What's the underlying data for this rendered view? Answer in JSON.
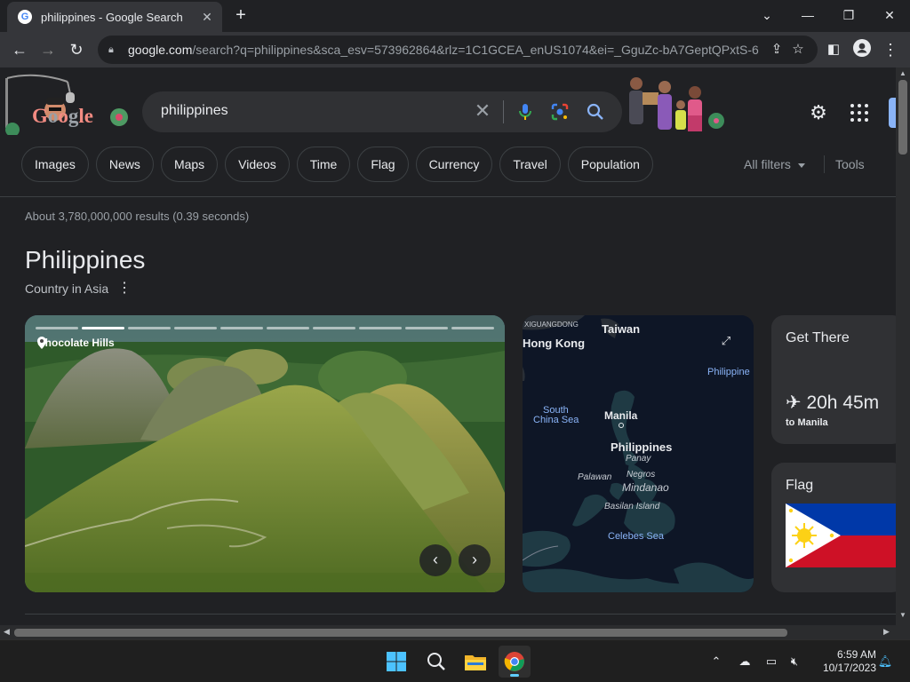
{
  "browser": {
    "tab": {
      "title": "philippines - Google Search",
      "favicon": "google-g-icon"
    },
    "new_tab": "+",
    "window_controls": [
      "minimize",
      "restore",
      "close"
    ],
    "url": "google.com/search?q=philippines&sca_esv=573962864&rlz=1C1GCEA_enUS1074&ei=_GguZc-bA7GeptQPxtS-6...",
    "url_host": "google.com",
    "url_path": "/search?q=philippines&sca_esv=573962864&rlz=1C1GCEA_enUS1074&ei=_GguZc-bA7GeptQPxtS-6..."
  },
  "search": {
    "doodle_text": "Google",
    "query": "philippines",
    "chips": [
      "Images",
      "News",
      "Maps",
      "Videos",
      "Time",
      "Flag",
      "Currency",
      "Travel",
      "Population"
    ],
    "all_filters": "All filters",
    "tools": "Tools",
    "stats": "About 3,780,000,000 results (0.39 seconds)"
  },
  "knowledge_panel": {
    "title": "Philippines",
    "subtitle": "Country in Asia",
    "hero": {
      "location": "Chocolate Hills",
      "slides": 10,
      "active_slide": 2
    },
    "map_labels": {
      "guangdong": "XIGUANGDONG",
      "taiwan": "Taiwan",
      "hong_kong": "Hong Kong",
      "philippine_sea": "Philippine",
      "south_china_sea_1": "South",
      "south_china_sea_2": "China Sea",
      "manila": "Manila",
      "philippines": "Philippines",
      "panay": "Panay",
      "negros": "Negros",
      "palawan": "Palawan",
      "mindanao": "Mindanao",
      "basilan": "Basilan Island",
      "celebes": "Celebes Sea"
    },
    "get_there": {
      "title": "Get There",
      "duration": "20h 45m",
      "destination": "to Manila"
    },
    "flag": {
      "title": "Flag",
      "colors": {
        "blue": "#0038a8",
        "red": "#ce1126",
        "white": "#ffffff",
        "gold": "#fcd116"
      }
    }
  },
  "taskbar": {
    "apps": [
      "windows-start",
      "search",
      "file-explorer",
      "chrome"
    ],
    "time": "6:59 AM",
    "date": "10/17/2023"
  },
  "colors": {
    "accent": "#8ab4f8",
    "background": "#202124",
    "surface": "#303134"
  }
}
